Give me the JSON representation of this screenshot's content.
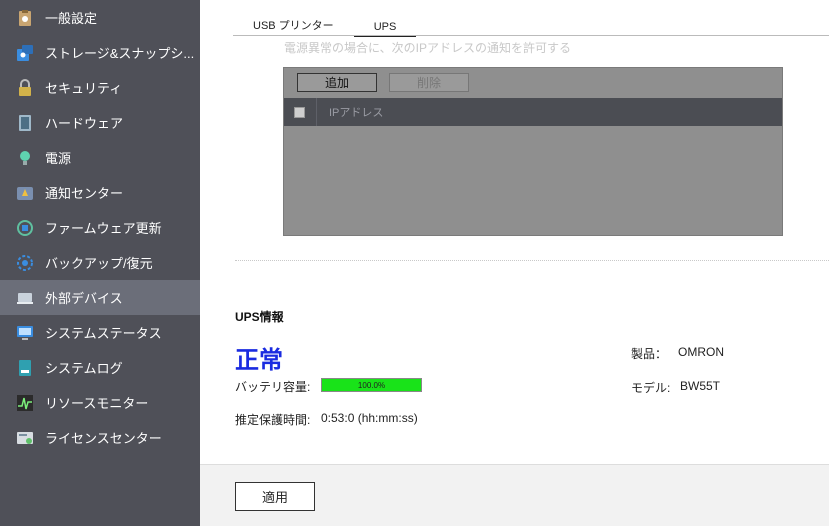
{
  "sidebar": {
    "items": [
      {
        "label": "一般設定",
        "icon": "clipboard-settings-icon"
      },
      {
        "label": "ストレージ&スナップシ...",
        "icon": "storage-icon"
      },
      {
        "label": "セキュリティ",
        "icon": "lock-icon"
      },
      {
        "label": "ハードウェア",
        "icon": "hardware-icon"
      },
      {
        "label": "電源",
        "icon": "power-bulb-icon"
      },
      {
        "label": "通知センター",
        "icon": "notification-icon"
      },
      {
        "label": "ファームウェア更新",
        "icon": "firmware-update-icon"
      },
      {
        "label": "バックアップ/復元",
        "icon": "backup-restore-icon"
      },
      {
        "label": "外部デバイス",
        "icon": "external-device-icon"
      },
      {
        "label": "システムステータス",
        "icon": "monitor-icon"
      },
      {
        "label": "システムログ",
        "icon": "log-icon"
      },
      {
        "label": "リソースモニター",
        "icon": "resource-monitor-icon"
      },
      {
        "label": "ライセンスセンター",
        "icon": "license-icon"
      }
    ],
    "active_index": 8
  },
  "tabs": [
    {
      "label": "USB プリンター"
    },
    {
      "label": "UPS"
    }
  ],
  "note": "電源異常の場合に、次のIPアドレスの通知を許可する",
  "ip_panel": {
    "add_label": "追加",
    "delete_label": "削除",
    "column_header": "IPアドレス"
  },
  "ups_info": {
    "title": "UPS情報",
    "status": "正常",
    "battery_label": "バッテリ容量:",
    "battery_percent": 100,
    "battery_text": "100.0%",
    "runtime_label": "推定保護時間:",
    "runtime_value": "0:53:0 (hh:mm:ss)",
    "product_label": "製品：",
    "product_value": "OMRON",
    "model_label": "モデル:",
    "model_value": "BW55T"
  },
  "footer": {
    "apply_label": "適用"
  },
  "colors": {
    "sidebar_bg": "#4f5058",
    "sidebar_active": "#6b6e79",
    "status_blue": "#1a2be0",
    "battery_green": "#19e319"
  }
}
